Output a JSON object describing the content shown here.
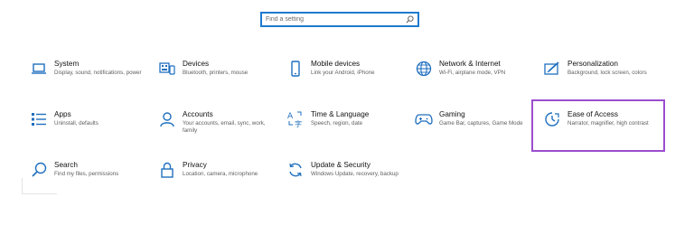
{
  "search": {
    "placeholder": "Find a setting"
  },
  "colors": {
    "icon": "#1f6fbf",
    "highlight": "#9b4dcf",
    "search_border": "#1f7ad0"
  },
  "tiles": [
    {
      "title": "System",
      "desc": "Display, sound, notifications, power",
      "icon": "laptop-icon"
    },
    {
      "title": "Devices",
      "desc": "Bluetooth, printers, mouse",
      "icon": "keyboard-icon"
    },
    {
      "title": "Mobile devices",
      "desc": "Link your Android, iPhone",
      "icon": "phone-icon"
    },
    {
      "title": "Network & Internet",
      "desc": "Wi-Fi, airplane mode, VPN",
      "icon": "globe-icon"
    },
    {
      "title": "Personalization",
      "desc": "Background, lock screen, colors",
      "icon": "pen-screen-icon"
    },
    {
      "title": "Apps",
      "desc": "Uninstall, defaults",
      "icon": "apps-list-icon"
    },
    {
      "title": "Accounts",
      "desc": "Your accounts, email, sync, work, family",
      "icon": "person-icon"
    },
    {
      "title": "Time & Language",
      "desc": "Speech, region, date",
      "icon": "language-icon"
    },
    {
      "title": "Gaming",
      "desc": "Game Bar, captures, Game Mode",
      "icon": "gamepad-icon"
    },
    {
      "title": "Ease of Access",
      "desc": "Narrator, magnifier, high contrast",
      "icon": "ease-of-access-icon"
    },
    {
      "title": "Search",
      "desc": "Find my files, permissions",
      "icon": "search-icon"
    },
    {
      "title": "Privacy",
      "desc": "Location, camera, microphone",
      "icon": "lock-icon"
    },
    {
      "title": "Update & Security",
      "desc": "Windows Update, recovery, backup",
      "icon": "sync-icon"
    }
  ]
}
